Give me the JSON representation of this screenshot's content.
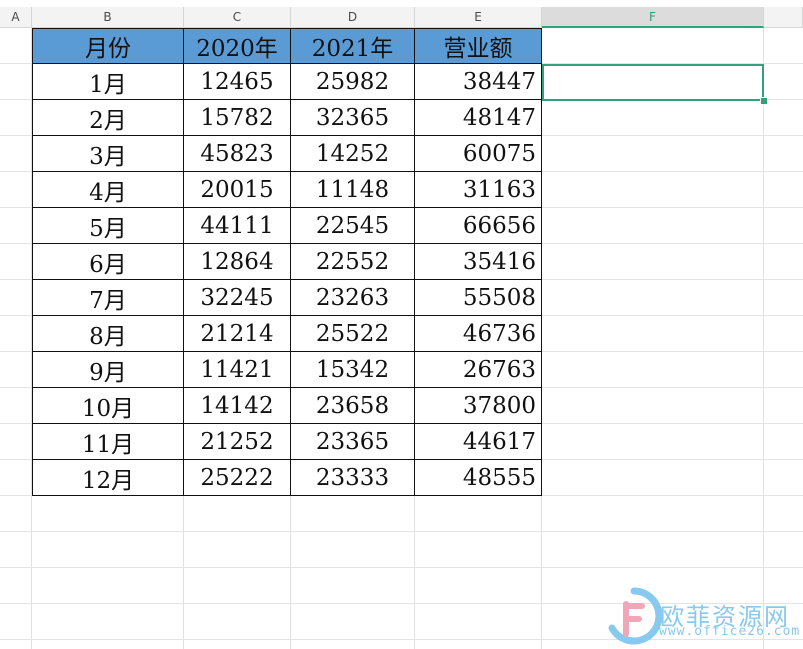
{
  "columns": [
    "A",
    "B",
    "C",
    "D",
    "E",
    "F"
  ],
  "selected_column": "F",
  "selected_cell": "F2",
  "table": {
    "headers": [
      "月份",
      "2020年",
      "2021年",
      "营业额"
    ],
    "rows": [
      [
        "1月",
        "12465",
        "25982",
        "38447"
      ],
      [
        "2月",
        "15782",
        "32365",
        "48147"
      ],
      [
        "3月",
        "45823",
        "14252",
        "60075"
      ],
      [
        "4月",
        "20015",
        "11148",
        "31163"
      ],
      [
        "5月",
        "44111",
        "22545",
        "66656"
      ],
      [
        "6月",
        "12864",
        "22552",
        "35416"
      ],
      [
        "7月",
        "32245",
        "23263",
        "55508"
      ],
      [
        "8月",
        "21214",
        "25522",
        "46736"
      ],
      [
        "9月",
        "11421",
        "15342",
        "26763"
      ],
      [
        "10月",
        "14142",
        "23658",
        "37800"
      ],
      [
        "11月",
        "21252",
        "23365",
        "44617"
      ],
      [
        "12月",
        "25222",
        "23333",
        "48555"
      ]
    ]
  },
  "colors": {
    "header_fill": "#5b9bd5",
    "selection": "#2fa37a",
    "watermark": "#88c9ef"
  },
  "watermark": {
    "name": "欧菲资源网",
    "url": "www.office26.com"
  }
}
